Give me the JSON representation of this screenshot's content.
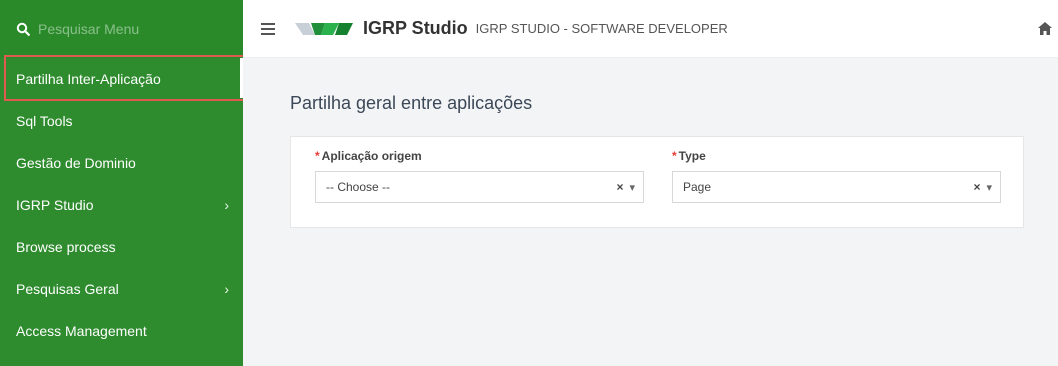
{
  "sidebar": {
    "search_placeholder": "Pesquisar Menu",
    "items": [
      {
        "label": "Partilha Inter-Aplicação",
        "has_children": false,
        "active": true
      },
      {
        "label": "Sql Tools",
        "has_children": false
      },
      {
        "label": "Gestão de Dominio",
        "has_children": false
      },
      {
        "label": "IGRP Studio",
        "has_children": true
      },
      {
        "label": "Browse process",
        "has_children": false
      },
      {
        "label": "Pesquisas Geral",
        "has_children": true
      },
      {
        "label": "Access Management",
        "has_children": false
      }
    ],
    "chevron": "›"
  },
  "header": {
    "brand": "IGRP Studio",
    "subtitle": "IGRP STUDIO - SOFTWARE DEVELOPER"
  },
  "main": {
    "title": "Partilha geral entre aplicações",
    "required_mark": "*",
    "fields": [
      {
        "label": "Aplicação origem",
        "value": "-- Choose --"
      },
      {
        "label": "Type",
        "value": "Page"
      }
    ],
    "clear_glyph": "×",
    "caret_glyph": "▾"
  },
  "colors": {
    "sidebar_bg": "#2e8b2e",
    "highlight_border": "#e05a4f",
    "content_bg": "#f3f4f6",
    "required": "#e53935"
  }
}
